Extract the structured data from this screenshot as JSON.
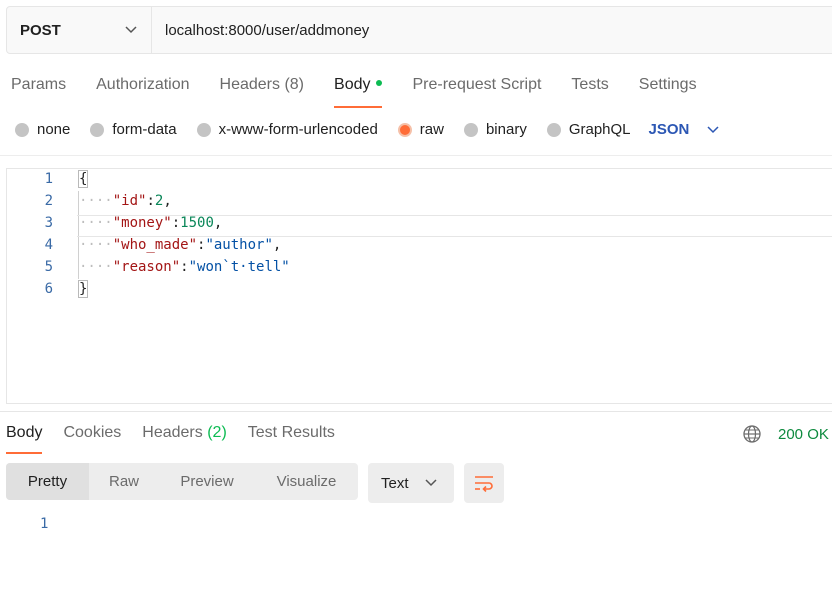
{
  "request": {
    "method": "POST",
    "url": "localhost:8000/user/addmoney"
  },
  "request_tabs": [
    {
      "label": "Params"
    },
    {
      "label": "Authorization"
    },
    {
      "label": "Headers",
      "count": "(8)"
    },
    {
      "label": "Body",
      "active": true
    },
    {
      "label": "Pre-request Script"
    },
    {
      "label": "Tests"
    },
    {
      "label": "Settings"
    }
  ],
  "body_types": {
    "none": "none",
    "form_data": "form-data",
    "urlencoded": "x-www-form-urlencoded",
    "raw": "raw",
    "binary": "binary",
    "graphql": "GraphQL",
    "selected": "raw",
    "language": "JSON"
  },
  "editor": {
    "line_numbers": [
      "1",
      "2",
      "3",
      "4",
      "5",
      "6"
    ],
    "lines": {
      "l1": "{",
      "l2_indent": "····",
      "l2_key": "\"id\"",
      "l2_colon": ":",
      "l2_val": "2",
      "l2_tail": ",",
      "l3_indent": "····",
      "l3_key": "\"money\"",
      "l3_colon": ":",
      "l3_val": "1500",
      "l3_tail": ",",
      "l4_indent": "····",
      "l4_key": "\"who_made\"",
      "l4_colon": ":",
      "l4_val": "\"author\"",
      "l4_tail": ",",
      "l5_indent": "····",
      "l5_key": "\"reason\"",
      "l5_colon": ":",
      "l5_val": "\"won`t·tell\"",
      "l6": "}"
    }
  },
  "response_tabs": [
    {
      "label": "Body",
      "active": true
    },
    {
      "label": "Cookies"
    },
    {
      "label": "Headers",
      "count": "(2)"
    },
    {
      "label": "Test Results"
    }
  ],
  "response": {
    "status": "200 OK",
    "views": [
      "Pretty",
      "Raw",
      "Preview",
      "Visualize"
    ],
    "format": "Text",
    "line_numbers": [
      "1"
    ]
  },
  "icons": {
    "method_dropdown": "chevron-down-icon",
    "language_dropdown": "chevron-down-icon",
    "network": "globe-icon",
    "wrap": "wrap-lines-icon"
  },
  "colors": {
    "accent": "#ff6c37",
    "status_green": "#0d8a3e",
    "language_blue": "#2c57b4",
    "key_red": "#a31515",
    "number_green": "#098658"
  }
}
